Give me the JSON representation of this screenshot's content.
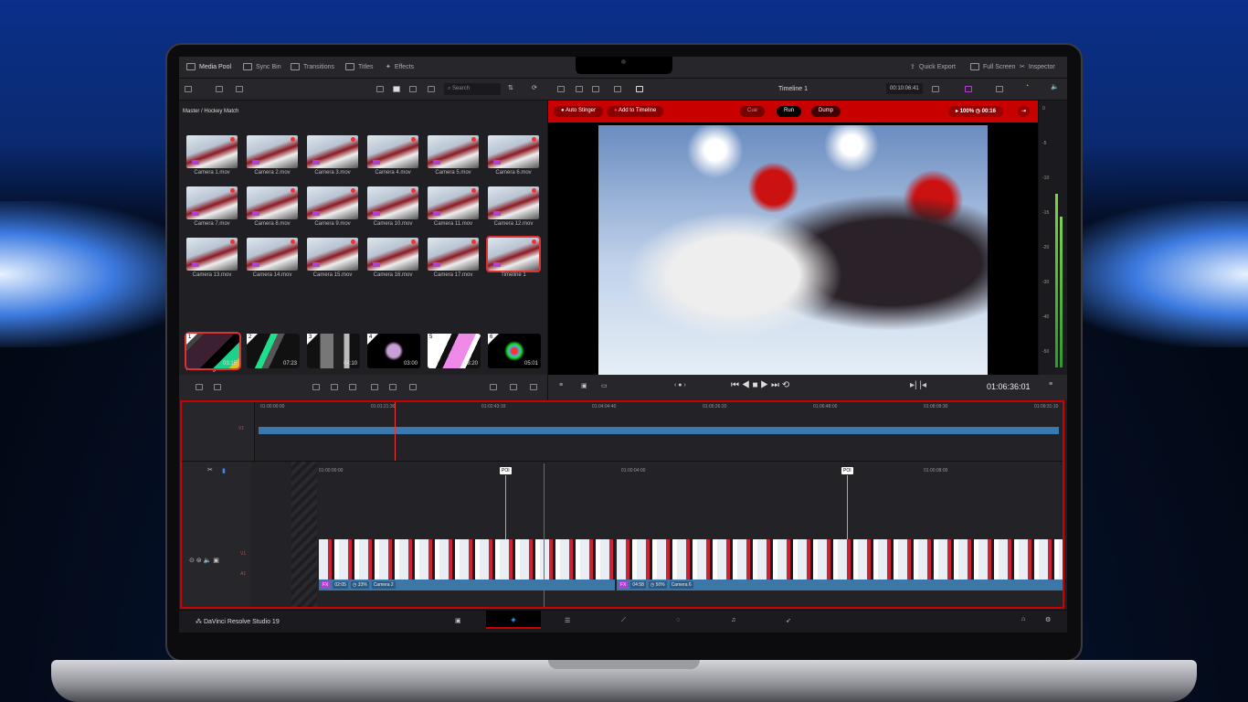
{
  "app": {
    "name": "DaVinci Resolve Studio 19"
  },
  "top_tabs": [
    {
      "label": "Media Pool"
    },
    {
      "label": "Sync Bin"
    },
    {
      "label": "Transitions"
    },
    {
      "label": "Titles"
    },
    {
      "label": "Effects"
    }
  ],
  "top_right": [
    {
      "label": "Quick Export"
    },
    {
      "label": "Full Screen"
    },
    {
      "label": "Inspector"
    }
  ],
  "search": {
    "placeholder": "Search"
  },
  "breadcrumb": "Master / Hockey Match",
  "clips": [
    "Camera 1.mov",
    "Camera 2.mov",
    "Camera 3.mov",
    "Camera 4.mov",
    "Camera 5.mov",
    "Camera 6.mov",
    "Camera 7.mov",
    "Camera 8.mov",
    "Camera 9.mov",
    "Camera 10.mov",
    "Camera 11.mov",
    "Camera 12.mov",
    "Camera 13.mov",
    "Camera 14.mov",
    "Camera 15.mov",
    "Camera 16.mov",
    "Camera 17.mov",
    "Timeline 1"
  ],
  "stingers": {
    "title": "Auto Stingers",
    "items": [
      {
        "n": "1",
        "d": "03:15"
      },
      {
        "n": "2",
        "d": "07:23"
      },
      {
        "n": "3",
        "d": "04:10"
      },
      {
        "n": "4",
        "d": "03:00"
      },
      {
        "n": "5",
        "d": "08:20"
      },
      {
        "n": "6",
        "d": "05:01"
      }
    ]
  },
  "viewer": {
    "timeline_name": "Timeline 1",
    "timecode_top": "00:10:06:41",
    "timecode": "01:06:36:01"
  },
  "replay_bar": {
    "auto_stinger": "Auto Stinger",
    "add_to_timeline": "Add to Timeline",
    "cue": "Cue",
    "run": "Run",
    "dump": "Dump",
    "speed": "100%",
    "duration": "00:16",
    "colors": {
      "bar": "#c80000"
    }
  },
  "meter_scale": [
    "0",
    "-5",
    "-10",
    "-15",
    "-20",
    "-30",
    "-40",
    "-50"
  ],
  "upper_ruler": [
    "01:00:00:00",
    "01:01:21:30",
    "01:02:43:10",
    "01:04:04:40",
    "01:05:26:20",
    "01:06:48:00",
    "01:08:09:30",
    "01:09:31:10"
  ],
  "lower_ruler": [
    "01:00:00:00",
    "01:00:04:00",
    "01:00:08:00"
  ],
  "track_labels": {
    "upper": "V1",
    "video": "V1",
    "audio": "A1"
  },
  "poi": "POI",
  "timeline_clips": [
    {
      "duration": "02:05",
      "speed": "33%",
      "name": "Camera 2"
    },
    {
      "duration": "04:58",
      "speed": "50%",
      "name": "Camera 6"
    }
  ],
  "fx_tag": "FX"
}
